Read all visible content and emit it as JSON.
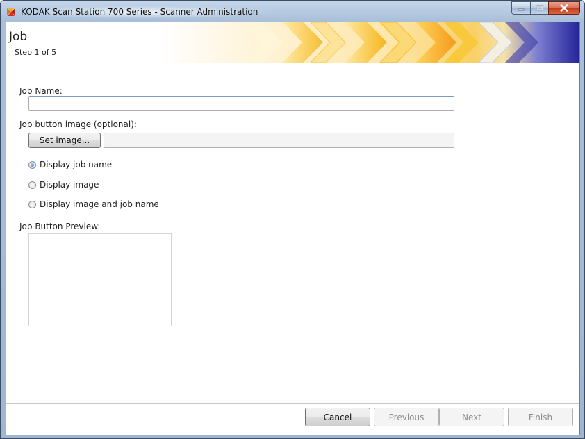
{
  "window": {
    "title": "KODAK Scan Station 700 Series - Scanner Administration",
    "icon": "kodak-app-icon",
    "controls": {
      "minimize": "minimize-icon",
      "maximize": "maximize-icon",
      "close": "close-icon"
    }
  },
  "header": {
    "title": "Job",
    "step": "Step 1 of 5"
  },
  "form": {
    "job_name_label": "Job Name:",
    "job_name_value": "",
    "job_button_image_label": "Job button image (optional):",
    "set_image_label": "Set image...",
    "image_path_value": "",
    "display_options": [
      {
        "label": "Display job name",
        "checked": true
      },
      {
        "label": "Display image",
        "checked": false
      },
      {
        "label": "Display image and job name",
        "checked": false
      }
    ],
    "preview_label": "Job Button Preview:"
  },
  "footer": {
    "cancel_label": "Cancel",
    "previous_label": "Previous",
    "next_label": "Next",
    "finish_label": "Finish"
  },
  "colors": {
    "banner_yellow": "#f7c21f",
    "banner_orange": "#f39a1b",
    "banner_blue": "#2c2c9c",
    "title_bar": "#b4c8e1",
    "close_red": "#c7432a"
  }
}
